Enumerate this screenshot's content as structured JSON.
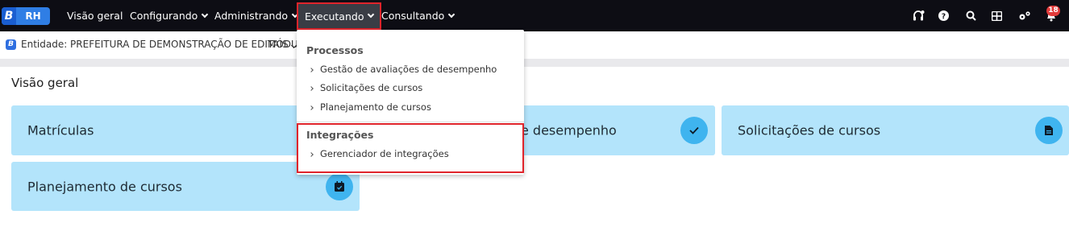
{
  "topbar": {
    "logo": {
      "letter": "B",
      "label": "RH"
    },
    "menu": [
      {
        "label": "Visão geral"
      },
      {
        "label": "Configurando"
      },
      {
        "label": "Administrando"
      },
      {
        "label": "Executando"
      },
      {
        "label": "Consultando"
      }
    ],
    "notifications_count": "18",
    "icons": [
      "headset-icon",
      "help-icon",
      "search-icon",
      "apps-grid-icon",
      "settings-icon",
      "bell-icon"
    ]
  },
  "subbar": {
    "entity_icon_letter": "B",
    "entity_label": "Entidade: PREFEITURA DE DEMONSTRAÇÃO DE EDITAIS",
    "module_label": "MÓDU"
  },
  "page": {
    "title": "Visão geral"
  },
  "cards": [
    {
      "label": "Matrículas"
    },
    {
      "label": "e desempenho",
      "icon": "check-icon"
    },
    {
      "label": "Solicitações de cursos",
      "icon": "document-icon"
    },
    {
      "label": "Planejamento de cursos",
      "icon": "calendar-check-icon"
    }
  ],
  "dropdown": {
    "sections": [
      {
        "header": "Processos",
        "items": [
          "Gestão de avaliações de desempenho",
          "Solicitações de cursos",
          "Planejamento de cursos"
        ]
      },
      {
        "header": "Integrações",
        "items": [
          "Gerenciador de integrações"
        ]
      }
    ]
  },
  "colors": {
    "topbar_bg": "#0d0d14",
    "card_bg": "#b3e4fb",
    "card_icon_bg": "#3fb4ef",
    "highlight_border": "#e0242b",
    "logo_blue": "#2f7ee5"
  }
}
